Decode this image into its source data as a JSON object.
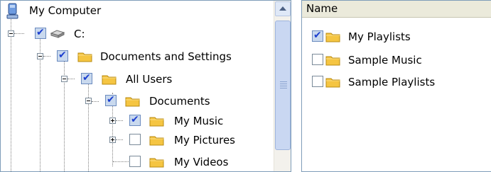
{
  "tree": {
    "root_label": "My Computer",
    "nodes": [
      {
        "label": "C:",
        "checked": true,
        "expanded": true,
        "icon": "drive-icon"
      },
      {
        "label": "Documents and Settings",
        "checked": true,
        "expanded": true,
        "icon": "folder-icon"
      },
      {
        "label": "All Users",
        "checked": true,
        "expanded": true,
        "icon": "folder-icon"
      },
      {
        "label": "Documents",
        "checked": true,
        "expanded": true,
        "icon": "folder-icon"
      },
      {
        "label": "My Music",
        "checked": true,
        "expanded": false,
        "icon": "folder-icon"
      },
      {
        "label": "My Pictures",
        "checked": false,
        "expanded": false,
        "icon": "folder-icon"
      },
      {
        "label": "My Videos",
        "checked": false,
        "expanded": null,
        "icon": "folder-icon"
      }
    ]
  },
  "list": {
    "column_header": "Name",
    "items": [
      {
        "label": "My Playlists",
        "checked": true
      },
      {
        "label": "Sample Music",
        "checked": false
      },
      {
        "label": "Sample Playlists",
        "checked": false
      }
    ]
  },
  "colors": {
    "checkmark": "#1c3fcf",
    "folder": "#f5c542",
    "pane_border": "#7f9db9"
  }
}
